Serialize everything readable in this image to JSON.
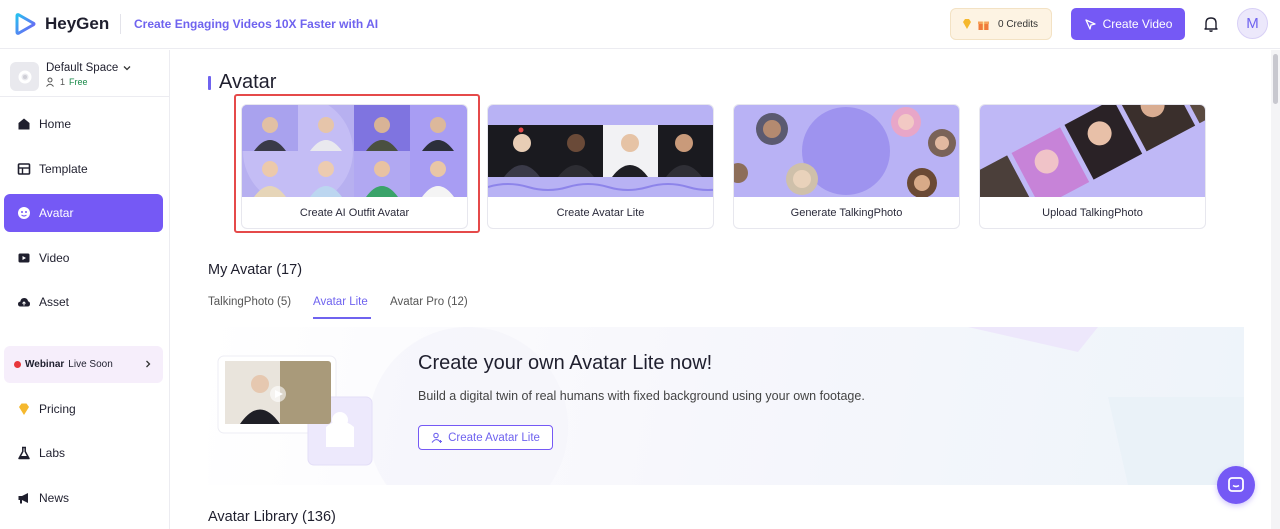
{
  "header": {
    "logo_text": "HeyGen",
    "tagline": "Create Engaging Videos 10X Faster with AI",
    "credits_label": "0 Credits",
    "create_video_label": "Create Video",
    "user_initial": "M"
  },
  "sidebar": {
    "space_name": "Default Space",
    "member_count": "1",
    "plan": "Free",
    "items": [
      {
        "label": "Home",
        "icon": "home-icon"
      },
      {
        "label": "Template",
        "icon": "template-icon"
      },
      {
        "label": "Avatar",
        "icon": "avatar-icon",
        "active": true
      },
      {
        "label": "Video",
        "icon": "video-icon"
      },
      {
        "label": "Asset",
        "icon": "cloud-icon"
      }
    ],
    "webinar_bold": "Webinar",
    "webinar_text": "Live Soon",
    "bottom_items": [
      {
        "label": "Pricing",
        "icon": "diamond-icon"
      },
      {
        "label": "Labs",
        "icon": "flask-icon"
      },
      {
        "label": "News",
        "icon": "megaphone-icon"
      }
    ]
  },
  "main": {
    "title": "Avatar",
    "cards": [
      {
        "label": "Create AI Outfit Avatar"
      },
      {
        "label": "Create Avatar Lite"
      },
      {
        "label": "Generate TalkingPhoto"
      },
      {
        "label": "Upload TalkingPhoto"
      }
    ],
    "my_avatar_title": "My Avatar (17)",
    "tabs": [
      {
        "label": "TalkingPhoto (5)"
      },
      {
        "label": "Avatar Lite",
        "active": true
      },
      {
        "label": "Avatar Pro (12)"
      }
    ],
    "promo": {
      "title": "Create your own Avatar Lite now!",
      "description": "Build a digital twin of real humans with fixed background using your own footage.",
      "button": "Create Avatar Lite"
    },
    "library_title": "Avatar Library (136)"
  },
  "colors": {
    "accent": "#7559f5",
    "highlight": "#e54a4a"
  }
}
